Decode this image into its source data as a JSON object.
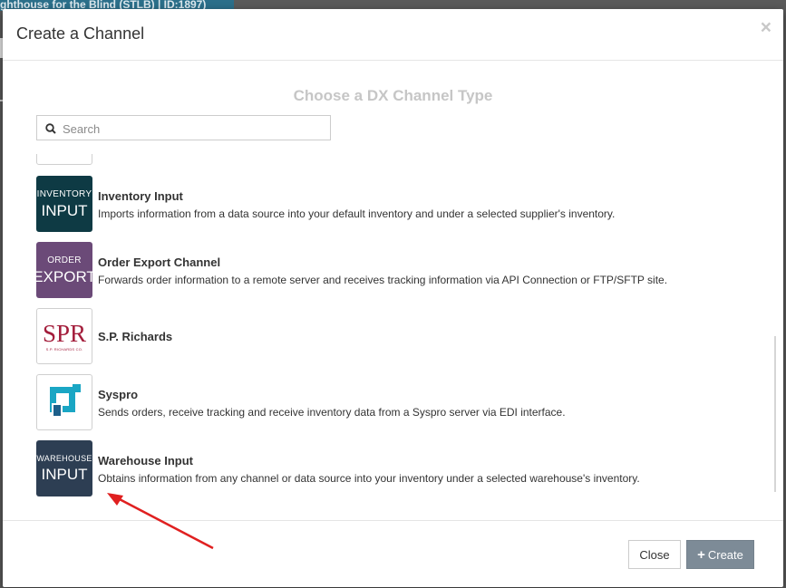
{
  "background": {
    "breadcrumb_text": "ghthouse for the Blind (STLB) | ID:1897)"
  },
  "modal": {
    "title": "Create a Channel",
    "close_symbol": "×",
    "subtitle": "Choose a DX Channel Type",
    "search": {
      "placeholder": "Search",
      "value": "",
      "icon": "search-icon"
    },
    "items": [
      {
        "tile_line1": "INVENTORY",
        "tile_line2": "INPUT",
        "tile_color": "#0e3a44",
        "name": "Inventory Input",
        "description": "Imports information from a data source into your default inventory and under a selected supplier's inventory."
      },
      {
        "tile_line1": "ORDER",
        "tile_line2": "EXPORT",
        "tile_color": "#6b4a78",
        "name": "Order Export Channel",
        "description": "Forwards order information to a remote server and receives tracking information via API Connection or FTP/SFTP site."
      },
      {
        "tile_logo": "SPR",
        "tile_logo_sub": "S.P. RICHARDS CO.",
        "name": "S.P. Richards",
        "description": ""
      },
      {
        "tile_icon": "syspro-logo-icon",
        "name": "Syspro",
        "description": "Sends orders, receive tracking and receive inventory data from a Syspro server via EDI interface."
      },
      {
        "tile_line1": "WAREHOUSE",
        "tile_line2": "INPUT",
        "tile_color": "#2d3e53",
        "name": "Warehouse Input",
        "description": "Obtains information from any channel or data source into your inventory under a selected warehouse's inventory."
      }
    ],
    "footer": {
      "close_label": "Close",
      "create_label": "Create",
      "create_icon": "plus-icon",
      "create_color": "#7d8b97"
    }
  },
  "annotation": {
    "arrow_color": "#e02020",
    "arrow_icon": "red-arrow-annotation"
  }
}
